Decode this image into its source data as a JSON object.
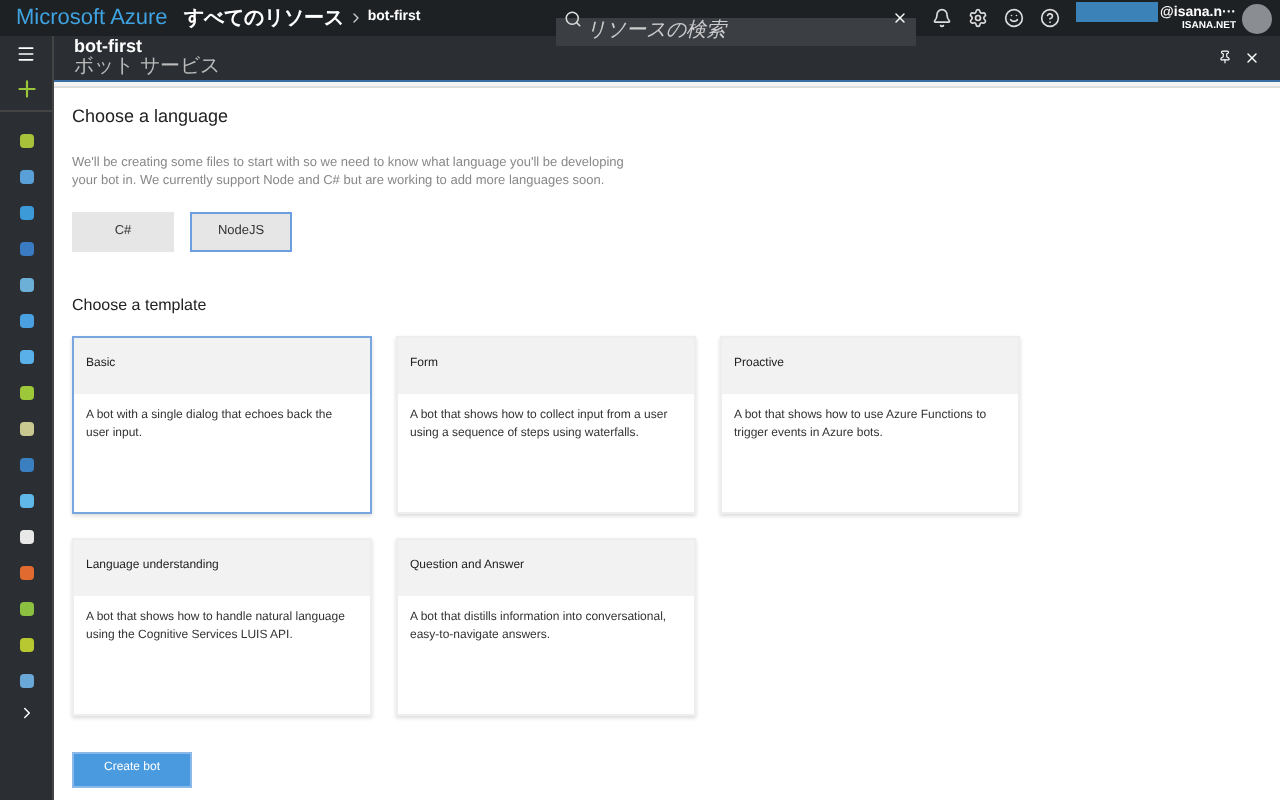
{
  "topbar": {
    "brand": "Microsoft Azure",
    "breadcrumb": [
      "すべてのリソース",
      "bot-first"
    ],
    "search": {
      "placeholder": "リソースの検索"
    },
    "account": {
      "user": "@isana.n···",
      "tenant": "ISANA.NET"
    }
  },
  "blade": {
    "title": "bot-first",
    "subtitle": "ボット サービス"
  },
  "language": {
    "heading": "Choose a language",
    "description": "We'll be creating some files to start with so we need to know what language you'll be developing your bot in. We currently support Node and C# but are working to add more languages soon.",
    "options": [
      {
        "label": "C#",
        "selected": false
      },
      {
        "label": "NodeJS",
        "selected": true
      }
    ]
  },
  "template": {
    "heading": "Choose a template",
    "cards": [
      {
        "title": "Basic",
        "description": "A bot with a single dialog that echoes back the user input.",
        "selected": true
      },
      {
        "title": "Form",
        "description": "A bot that shows how to collect input from a user using a sequence of steps using waterfalls.",
        "selected": false
      },
      {
        "title": "Proactive",
        "description": "A bot that shows how to use Azure Functions to trigger events in Azure bots.",
        "selected": false
      },
      {
        "title": "Language understanding",
        "description": "A bot that shows how to handle natural language using the Cognitive Services LUIS API.",
        "selected": false
      },
      {
        "title": "Question and Answer",
        "description": "A bot that distills information into conversational, easy-to-navigate answers.",
        "selected": false
      }
    ]
  },
  "create_button": "Create bot"
}
